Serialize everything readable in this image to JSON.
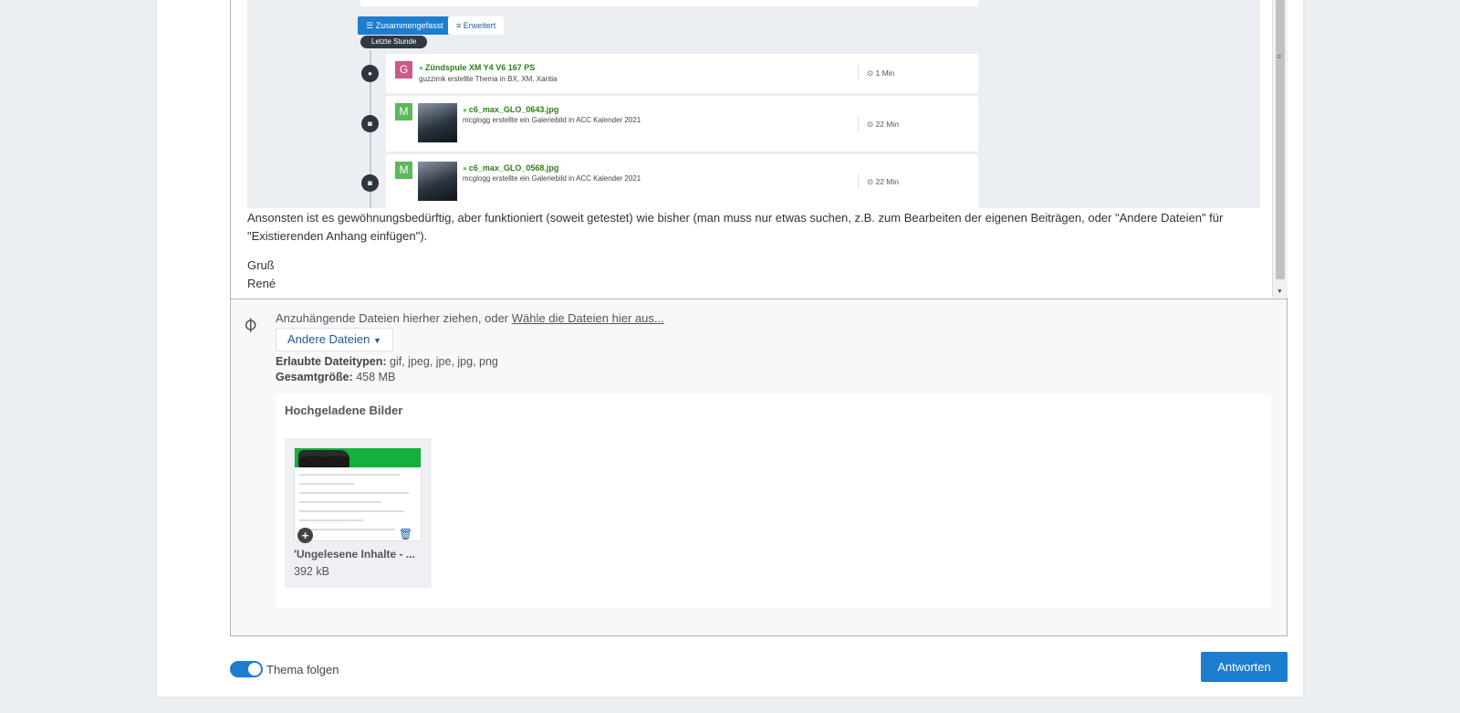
{
  "embedded_screenshot": {
    "tabs": {
      "summary": "Zusammengefasst",
      "extended": "Erweitert"
    },
    "time_pill": "Letzte Stunde",
    "activities": [
      {
        "avatar": "G",
        "avatar_color": "#c95a8a",
        "title": "Zündspule XM Y4 V6 167 PS",
        "subtitle": "guzzimk erstellte Thema in BX, XM, Xantia",
        "time": "1 Min",
        "icon": "comment-icon"
      },
      {
        "avatar": "M",
        "avatar_color": "#5cb85c",
        "title": "c6_max_GLO_0643.jpg",
        "subtitle": "mcglogg erstellte ein Galeriebild in ACC Kalender 2021",
        "time": "22 Min",
        "icon": "camera-icon"
      },
      {
        "avatar": "M",
        "avatar_color": "#5cb85c",
        "title": "c6_max_GLO_0568.jpg",
        "subtitle": "mcglogg erstellte ein Galeriebild in ACC Kalender 2021",
        "time": "22 Min",
        "icon": "camera-icon"
      }
    ]
  },
  "post_text": {
    "line1": "Ansonsten ist es gewöhnungsbedürftig, aber funktioniert (soweit getestet) wie bisher (man muss nur etwas suchen, z.B. zum Bearbeiten der eigenen Beiträgen, oder \"Andere Dateien\" für",
    "line2": "\"Existierenden Anhang einfügen\").",
    "greeting": "Gruß",
    "name": "René"
  },
  "attachments": {
    "drop_text": "Anzuhängende Dateien hierher ziehen, oder ",
    "choose_link": "Wähle die Dateien hier aus...",
    "other_files_button": "Andere Dateien",
    "allowed_label": "Erlaubte Dateitypen:",
    "allowed_value": " gif, jpeg, jpe, jpg, png",
    "total_label": "Gesamtgröße:",
    "total_value": " 458 MB",
    "uploaded_heading": "Hochgeladene Bilder",
    "images": [
      {
        "name": "'Ungelesene Inhalte - ...",
        "size": "392 kB"
      }
    ]
  },
  "footer": {
    "follow_label": "Thema folgen",
    "follow_on": true,
    "reply_button": "Antworten"
  },
  "colors": {
    "accent": "#1d7dcf",
    "background": "#ebeef3"
  }
}
